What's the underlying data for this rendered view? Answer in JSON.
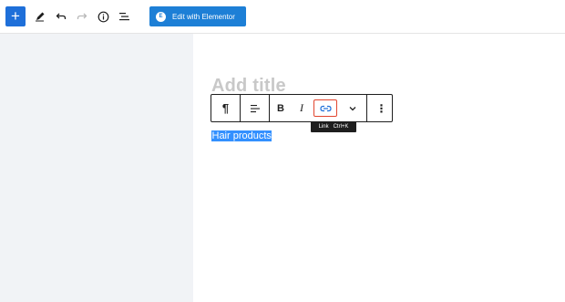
{
  "toolbar": {
    "add_icon": "plus-icon",
    "edit_icon": "pencil-icon",
    "undo_icon": "undo-icon",
    "redo_icon": "redo-icon",
    "info_icon": "info-icon",
    "outline_icon": "list-view-icon",
    "elementor_button_label": "Edit with Elementor",
    "elementor_logo_text": "E"
  },
  "editor": {
    "title_placeholder": "Add title",
    "paragraph_text": "Hair products"
  },
  "block_toolbar": {
    "paragraph_icon": "¶",
    "align_icon": "align-left-icon",
    "bold_label": "B",
    "italic_label": "I",
    "link_icon": "link-icon",
    "more_rich_text_icon": "chevron-down-icon",
    "options_icon": "⋮"
  },
  "tooltip": {
    "label": "Link",
    "shortcut": "Ctrl+K"
  },
  "colors": {
    "accent": "#1e6fd9",
    "elementor": "#1d7fd6",
    "selection": "#3390ff",
    "link_highlight": "#e2462f"
  }
}
